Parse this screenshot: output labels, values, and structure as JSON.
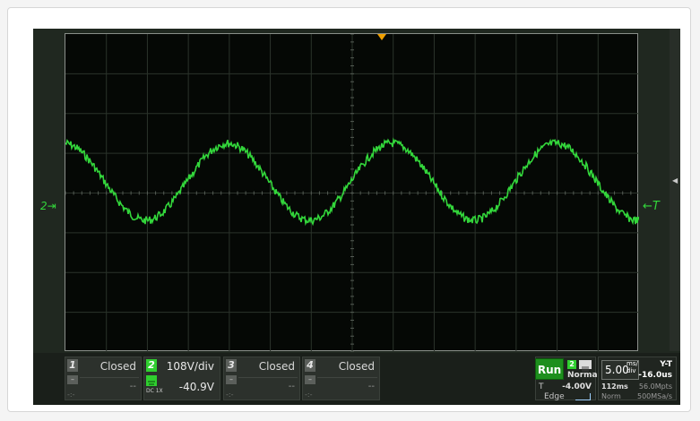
{
  "colors": {
    "trace": "#33d63b",
    "grid": "#2b332b",
    "trigger_marker": "#f0a000",
    "run": "#1d8f1d",
    "channel_active": "#2fcf2f"
  },
  "screen": {
    "channel_marker": "2",
    "trigger_label": "T"
  },
  "channels": [
    {
      "number": "1",
      "label": "Closed",
      "value": "--",
      "footer": "-:-"
    },
    {
      "number": "2",
      "label": "108V/div",
      "value": "-40.9V",
      "coupling": "DC 1X",
      "footer": ""
    },
    {
      "number": "3",
      "label": "Closed",
      "value": "--",
      "footer": "-:-"
    },
    {
      "number": "4",
      "label": "Closed",
      "value": "--",
      "footer": "-:-"
    }
  ],
  "acquisition": {
    "run_state": "Run"
  },
  "trigger": {
    "source": "2",
    "mode": "Normal",
    "prefix": "T",
    "level": "-4.00V",
    "type": "Edge"
  },
  "timebase": {
    "scale": "5.00",
    "scale_unit_top": "ms/",
    "scale_unit_bottom": "div",
    "mode": "Y-T",
    "offset": "-16.0us",
    "memory_time": "112ms",
    "points": "56.0Mpts",
    "acq_mode": "Norm",
    "sample_rate": "500MSa/s"
  },
  "icons": {
    "trigger_position": "trigger-position-icon",
    "channel_ground": "channel-ground-icon",
    "trigger_menu": "menu-icon",
    "edge": "rising-edge-icon",
    "collapse": "chevron-left-icon"
  }
}
